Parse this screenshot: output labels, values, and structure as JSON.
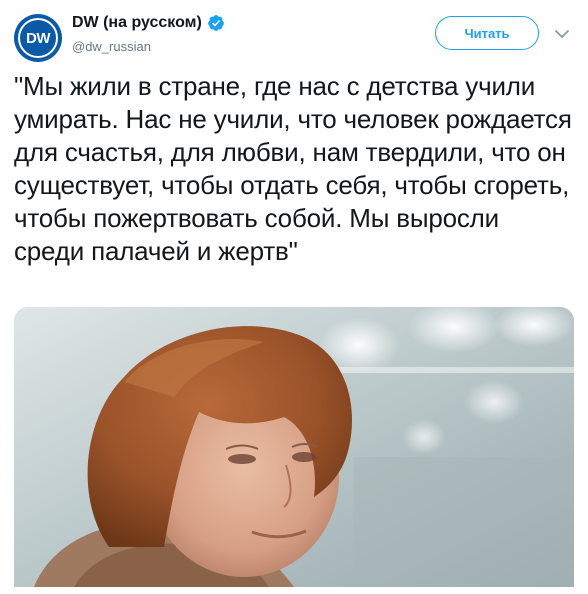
{
  "account": {
    "avatar_text": "DW",
    "display_name": "DW (на русском)",
    "handle": "@dw_russian",
    "verified": true
  },
  "follow_button_label": "Читать",
  "tweet": {
    "text": "\"Мы жили в стране, где нас с детства учили умирать. Нас не учили, что человек рождается для счастья, для любви, нам твердили, что он существует, чтобы отдать себя, чтобы сгореть, чтобы пожертвовать собой. Мы выросли среди палачей и жертв\""
  },
  "media": {
    "type": "photo"
  },
  "colors": {
    "accent": "#1da1f2",
    "avatar_bg": "#0a5aa8",
    "handle": "#657786"
  },
  "icons": {
    "verified": "verified-badge-icon",
    "caret": "chevron-down-icon"
  }
}
